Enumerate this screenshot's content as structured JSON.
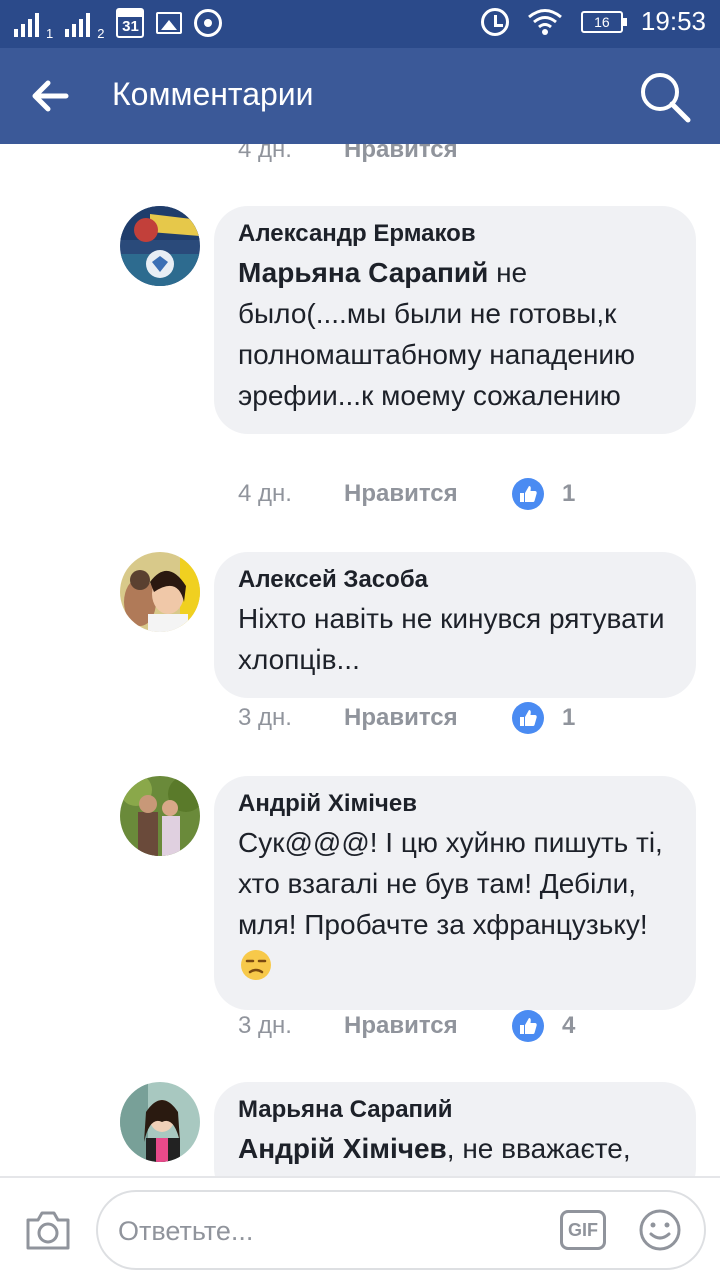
{
  "status_bar": {
    "sim1_label": "1",
    "sim2_label": "2",
    "calendar_day": "31",
    "battery": "16",
    "time": "19:53"
  },
  "header": {
    "title": "Комментарии"
  },
  "partial_meta": {
    "time": "4 дн.",
    "like_label": "Нравится"
  },
  "comments": [
    {
      "author": "Александр Ермаков",
      "mention": "Марьяна Сарапий",
      "text": " не было(....мы были не готовы,к полномаштабному нападению эрефии...к моему сожалению",
      "time": "4 дн.",
      "like_label": "Нравится",
      "likes": "1"
    },
    {
      "author": "Алексей Засоба",
      "mention": "",
      "text": "Ніхто навіть не кинувся рятувати хлопців...",
      "time": "3 дн.",
      "like_label": "Нравится",
      "likes": "1"
    },
    {
      "author": "Андрій Хімічев",
      "mention": "",
      "text": "Сук@@@! І цю хуйню пишуть ті, хто взагалі не був там! Дебіли, мля! Пробачте за хфранцузьку!",
      "time": "3 дн.",
      "like_label": "Нравится",
      "likes": "4"
    },
    {
      "author": "Марьяна Сарапий",
      "mention": "Андрій Хімічев",
      "text": ", не вважаєте,",
      "time": "",
      "like_label": "",
      "likes": ""
    }
  ],
  "compose": {
    "placeholder": "Ответьте...",
    "gif_label": "GIF"
  },
  "colors": {
    "status_bar": "#2b4a8a",
    "app_bar": "#3b5998",
    "bubble": "#f0f1f4",
    "like_icon": "#4a8bf2"
  },
  "icons": [
    "back-arrow-icon",
    "search-icon",
    "like-thumb-icon",
    "camera-icon",
    "gif-icon",
    "emoji-icon",
    "unamused-emoji-icon"
  ]
}
